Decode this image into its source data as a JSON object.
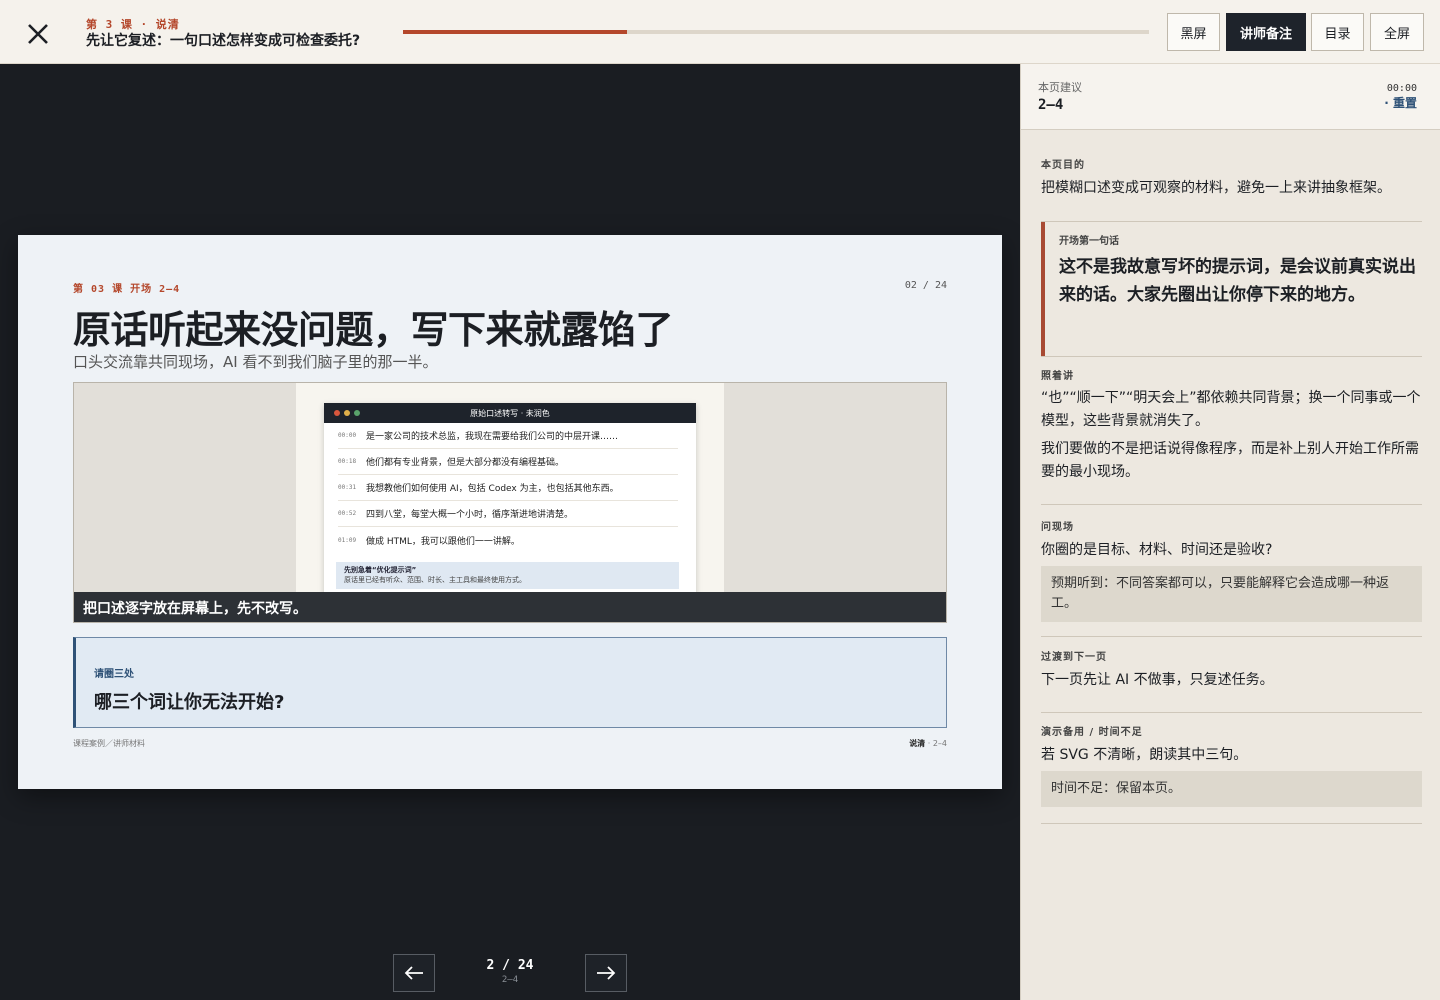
{
  "topbar": {
    "kicker": "第 3 课 · 说清",
    "title": "先让它复述：一句口述怎样变成可检查委托?",
    "progress": 0.3,
    "buttons": {
      "blackscreen": "黑屏",
      "notes": "讲师备注",
      "toc": "目录",
      "fullscreen": "全屏"
    }
  },
  "slide": {
    "kicker": "第 03 课  开场  2–4",
    "pagenum": "02 / 24",
    "title": "原话听起来没问题，写下来就露馅了",
    "subtitle": "口头交流靠共同现场，AI 看不到我们脑子里的那一半。",
    "transcript": {
      "window_title": "原始口述转写 · 未润色",
      "rows": [
        {
          "time": "00:00",
          "text": "是一家公司的技术总监，我现在需要给我们公司的中层开课……"
        },
        {
          "time": "00:18",
          "text": "他们都有专业背景，但是大部分都没有编程基础。"
        },
        {
          "time": "00:31",
          "text": "我想教他们如何使用 AI，包括 Codex 为主，也包括其他东西。"
        },
        {
          "time": "00:52",
          "text": "四到八堂，每堂大概一个小时，循序渐进地讲清楚。"
        },
        {
          "time": "01:09",
          "text": "做成 HTML，我可以跟他们一一讲解。"
        }
      ],
      "note_title": "先别急着“优化提示词”",
      "note_text": "原话里已经有听众、范围、时长、主工具和最终使用方式。"
    },
    "caption": "把口述逐字放在屏幕上，先不改写。",
    "prompt_kicker": "请圈三处",
    "prompt_question": "哪三个词让你无法开始?",
    "footer_left": "课程案例／讲师材料",
    "footer_right_bold": "说清",
    "footer_right_rest": " · 2–4"
  },
  "pager": {
    "main": "2 / 24",
    "sub": "2–4"
  },
  "panel": {
    "suggest_label": "本页建议",
    "suggest_value": "2–4",
    "timer": "00:00",
    "reset": "· 重置",
    "purpose_label": "本页目的",
    "purpose_text": "把模糊口述变成可观察的材料，避免一上来讲抽象框架。",
    "opening_label": "开场第一句话",
    "opening_text": "这不是我故意写坏的提示词，是会议前真实说出来的话。大家先圈出让你停下来的地方。",
    "follow_label": "照着讲",
    "follow_text1": "“也”“顺一下”“明天会上”都依赖共同背景；换一个同事或一个模型，这些背景就消失了。",
    "follow_text2": "我们要做的不是把话说得像程序，而是补上别人开始工作所需要的最小现场。",
    "ask_label": "问现场",
    "ask_text": "你圈的是目标、材料、时间还是验收?",
    "ask_expect": "预期听到：不同答案都可以，只要能解释它会造成哪一种返工。",
    "transition_label": "过渡到下一页",
    "transition_text": "下一页先让 AI 不做事，只复述任务。",
    "backup_label": "演示备用  /  时间不足",
    "backup_text": "若 SVG 不清晰，朗读其中三句。",
    "backup_expect": "时间不足：保留本页。"
  }
}
